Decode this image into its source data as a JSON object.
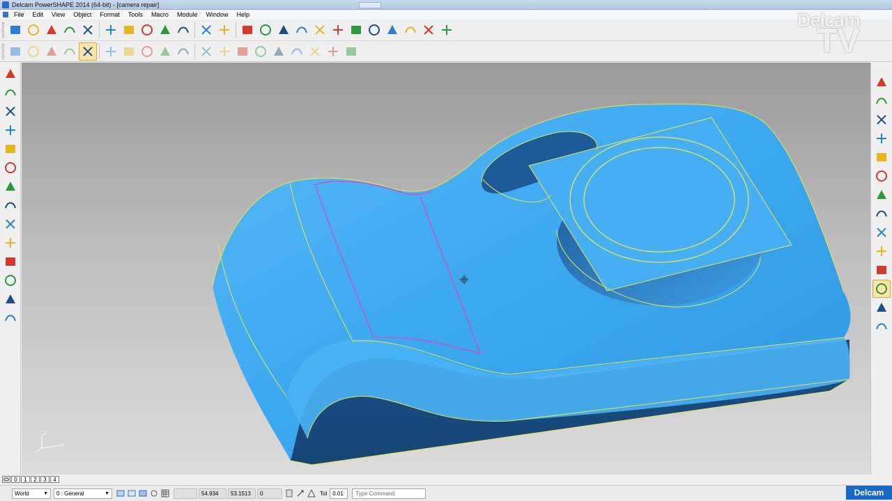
{
  "window": {
    "title": "Delcam PowerSHAPE 2014 (64-bit) - [camera repair]"
  },
  "menu": [
    "File",
    "Edit",
    "View",
    "Object",
    "Format",
    "Tools",
    "Macro",
    "Module",
    "Window",
    "Help"
  ],
  "watermark": {
    "line1": "Delcam",
    "line2": "TV"
  },
  "toolbar_row1": [
    "new-icon",
    "open-icon",
    "import-icon",
    "save-icon",
    "print-icon",
    "cut-icon",
    "copy-icon",
    "paste-icon",
    "edit-icon",
    "delete-icon",
    "undo-icon",
    "redo-icon",
    "sketch-icon",
    "wireframe-icon",
    "line-icon",
    "curve-icon",
    "circle-icon",
    "arc-icon",
    "text-icon",
    "surface-icon",
    "solid-icon",
    "layers-icon",
    "settings-icon",
    "magic-icon"
  ],
  "toolbar_row2": [
    "select-surface-icon",
    "fillet-icon",
    "blend-icon",
    "patch-icon",
    "trim-icon",
    "repair-icon",
    "shape-icon",
    "shape2-icon",
    "shape3-icon",
    "shape4-icon",
    "curve-edit-icon",
    "curve-edit2-icon",
    "curve-edit3-icon",
    "curve-edit4-icon",
    "curve-edit5-icon",
    "curve-edit6-icon",
    "curve-edit7-icon",
    "curve-edit8-icon",
    "arch-icon"
  ],
  "toolbar_row2_active": 4,
  "left_tools": [
    "select-icon",
    "rotate-view-icon",
    "curve-tool-icon",
    "fillet-tool-icon",
    "surface-tool-icon",
    "solid-tool-icon",
    "feature-tool-icon",
    "box-tool-icon",
    "cube-tool-icon",
    "pattern-tool-icon",
    "wave-tool-icon",
    "arrows-tool-icon",
    "shell-tool-icon",
    "wedge-tool-icon"
  ],
  "right_tools": [
    "view-top-icon",
    "view-front-icon",
    "view-right-icon",
    "view-iso-icon",
    "view-iso2-icon",
    "view-select-icon",
    "view-undo-icon",
    "zoom-fit-icon",
    "zoom-box-icon",
    "wireframe-view-icon",
    "shaded-view-icon",
    "shaded-edges-icon",
    "render-view-icon",
    "analysis-view-icon"
  ],
  "levels": [
    "0",
    "1",
    "2",
    "3",
    "4"
  ],
  "status": {
    "workplane": "World",
    "level_select": "0 : General",
    "coord_x": "54.934",
    "coord_y": "53.1513",
    "coord_z": "0",
    "tol_label": "Tol",
    "tol_value": "0.01",
    "command_placeholder": "Type Command",
    "brand": "Delcam"
  },
  "axis_labels": {
    "z": "Z",
    "x": "X"
  },
  "colors": {
    "model_face": "#3aa8f2",
    "model_side": "#1b4f86",
    "edge_yellow": "#e6e64a",
    "edge_magenta": "#e040c8",
    "brand": "#1669c9"
  }
}
